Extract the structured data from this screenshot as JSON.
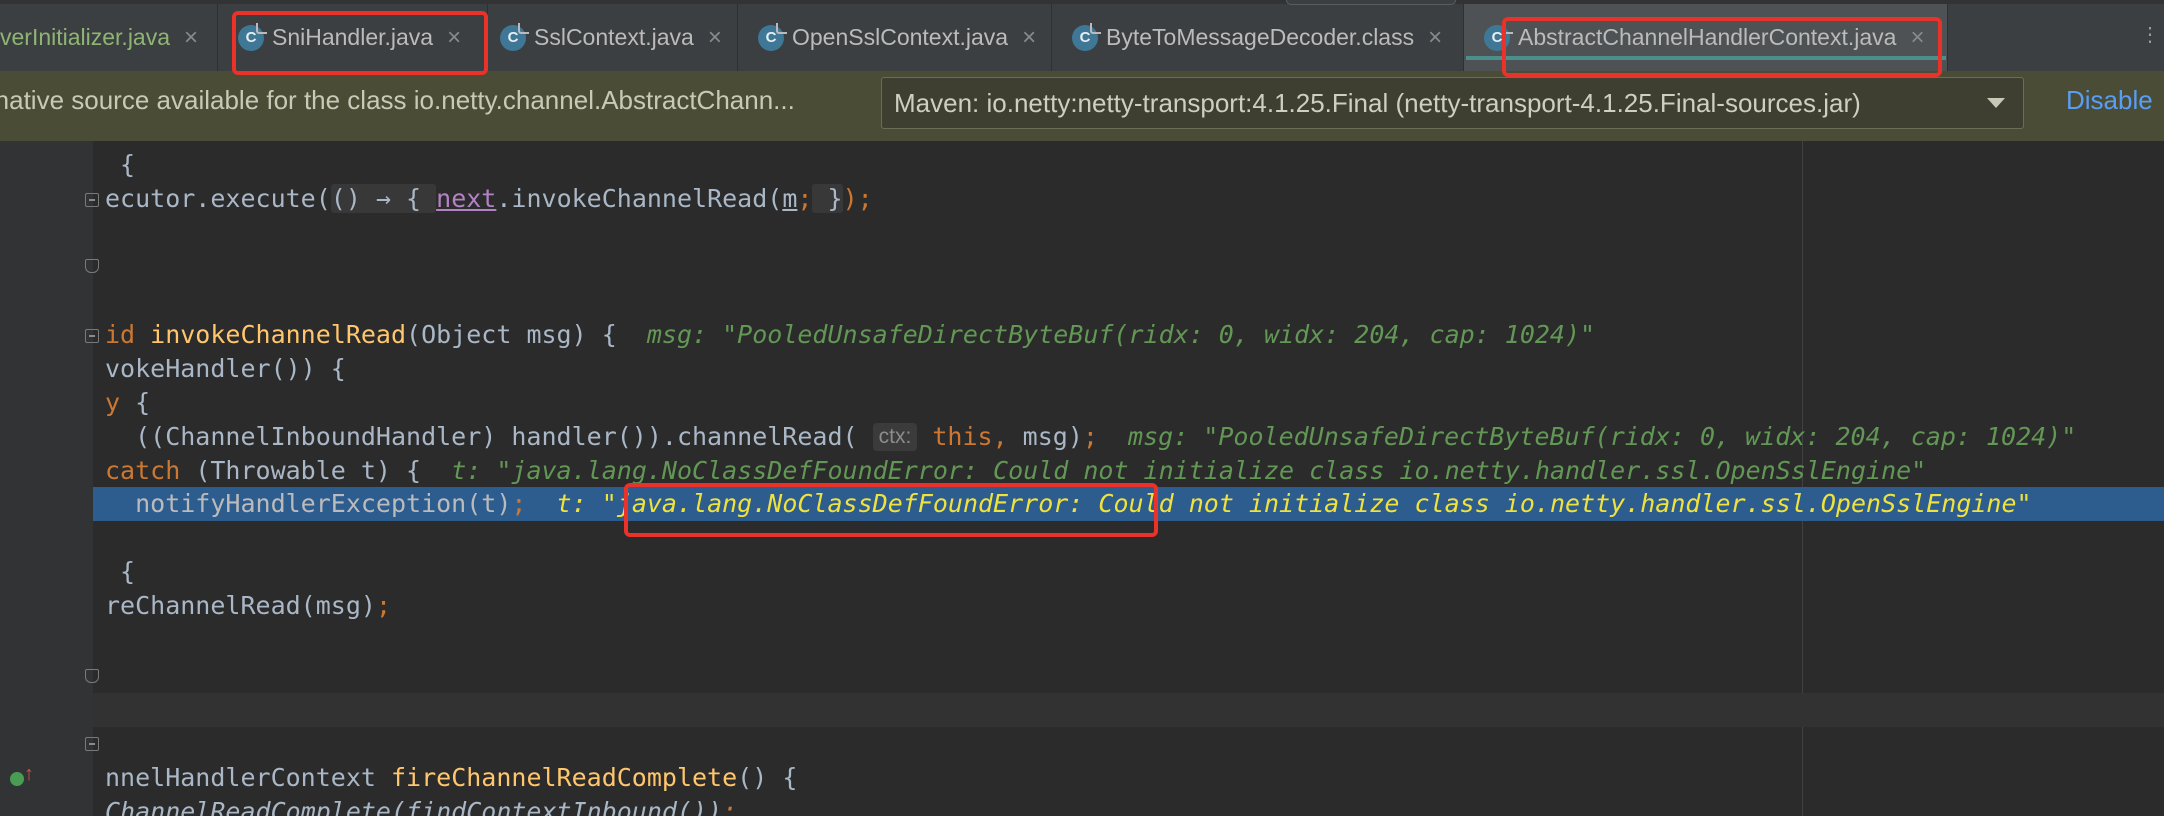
{
  "tabs": [
    {
      "label": "verInitializer.java",
      "active": false
    },
    {
      "label": "SniHandler.java",
      "active": false
    },
    {
      "label": "SslContext.java",
      "active": false
    },
    {
      "label": "OpenSslContext.java",
      "active": false
    },
    {
      "label": "ByteToMessageDecoder.class",
      "active": false
    },
    {
      "label": "AbstractChannelHandlerContext.java",
      "active": true
    }
  ],
  "tab_icon_letter": "C",
  "tab_close_glyph": "×",
  "tab_menu_glyph": "⋮",
  "banner": {
    "message": "rnative source available for the class io.netty.channel.AbstractChann...",
    "selected_source": "Maven: io.netty:netty-transport:4.1.25.Final (netty-transport-4.1.25.Final-sources.jar)",
    "disable_label": "Disable"
  },
  "code": {
    "l1": {
      "a": " {"
    },
    "l2": {
      "a": "ecutor.execute(",
      "b": "() → { ",
      "c": "next",
      "d": ".invokeChannelRead(",
      "e": "m",
      "f": ";",
      "g": " }",
      "h": ");"
    },
    "l3": {
      "a": "id ",
      "b": "invokeChannelRead",
      "c": "(Object msg) {  ",
      "d": "msg: \"PooledUnsafeDirectByteBuf(ridx: 0, widx: 204, cap: 1024)\""
    },
    "l4": {
      "a": "vokeHandler()) {"
    },
    "l5": {
      "a": "y ",
      "b": "{"
    },
    "l6": {
      "a": "  ((ChannelInboundHandler) handler()).channelRead( ",
      "b": "ctx:",
      "c": " this",
      "d": ",",
      "e": " msg)",
      "f": ";",
      "g": "  msg: \"PooledUnsafeDirectByteBuf(ridx: 0, widx: 204, cap: 1024)\""
    },
    "l7": {
      "a": "catch",
      "b": " (Throwable t) {  ",
      "c": "t: \"java.lang.NoClassDefFoundError: Could not initialize class io.netty.handler.ssl.OpenSslEngine\""
    },
    "l8": {
      "a": "  notifyHandlerException(t)",
      "b": ";",
      "c": "  t: ",
      "d": "\"java.lang.NoClassDefFoundError:",
      "e": " Could not initialize class io.netty.handler.ssl.OpenSslEngine\""
    },
    "l9": {
      "a": " {"
    },
    "l10": {
      "a": "reChannelRead(msg)",
      "b": ";"
    },
    "l11": {
      "a": "nnelHandlerContext ",
      "b": "fireChannelReadComplete",
      "c": "() {"
    },
    "l12": {
      "a": "ChannelReadComplete(findContextInbound())",
      "b": ";"
    }
  },
  "colors": {
    "highlight": "#2d5c8f",
    "annotation_red": "#e8322a",
    "link_blue": "#589df6"
  }
}
